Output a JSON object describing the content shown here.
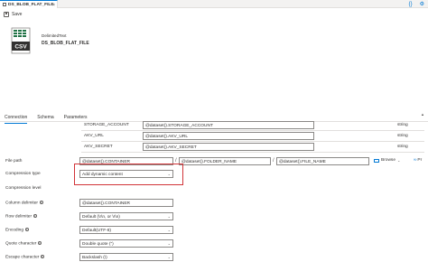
{
  "tab": {
    "title": "DS_BLOB_FLAT_FILE",
    "close": "×"
  },
  "top_actions": {
    "code": "{}",
    "settings": "⚙"
  },
  "toolbar": {
    "save_label": "Save"
  },
  "dataset": {
    "type": "DelimitedText",
    "name": "DS_BLOB_FLAT_FILE",
    "icon_text": "CSV"
  },
  "panel_tabs": [
    "Connection",
    "Schema",
    "Parameters"
  ],
  "param_rows": [
    {
      "key": "STORAGE_ACCOUNT",
      "value": "@dataset().STORAGE_ACCOUNT",
      "type": "string"
    },
    {
      "key": "AKV_URL",
      "value": "@dataset().AKV_URL",
      "type": "string"
    },
    {
      "key": "AKV_SECRET",
      "value": "@dataset().AKV_SECRET",
      "type": "string"
    }
  ],
  "file_path": {
    "label": "File path",
    "container": "@dataset().CONTAINER",
    "folder": "@dataset().FOLDER_NAME",
    "file": "@dataset().FILE_NAME",
    "sep": "/",
    "browse": "Browse",
    "preview": "Pr"
  },
  "fields": {
    "compression_type": {
      "label": "Compression type",
      "value": "Add dynamic content"
    },
    "compression_level": {
      "label": "Compression level"
    },
    "column_delimiter": {
      "label": "Column delimiter",
      "value": "@dataset().CONTAINER"
    },
    "row_delimiter": {
      "label": "Row delimiter",
      "value": "Default (\\r\\n, or \\r\\n)"
    },
    "encoding": {
      "label": "Encoding",
      "value": "Default(UTF-8)"
    },
    "quote_character": {
      "label": "Quote character",
      "value": "Double quote (\")"
    },
    "escape_character": {
      "label": "Escape character",
      "value": "Backslash (\\)"
    }
  },
  "colors": {
    "accent": "#0078d4",
    "highlight": "#d13438",
    "csv_green": "#217346"
  }
}
